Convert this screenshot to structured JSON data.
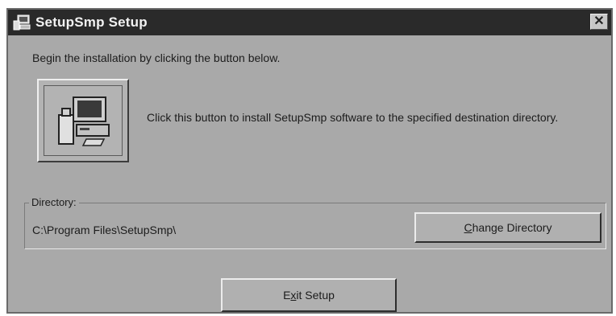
{
  "window": {
    "title": "SetupSmp Setup",
    "close_glyph": "✕"
  },
  "intro_text": "Begin the installation by clicking the button below.",
  "install": {
    "icon": "computer-install-icon",
    "description": "Click this button to install SetupSmp software to the specified destination directory."
  },
  "directory": {
    "legend": "Directory:",
    "path": "C:\\Program Files\\SetupSmp\\"
  },
  "buttons": {
    "change_directory": {
      "mnemonic": "C",
      "rest": "hange Directory"
    },
    "exit_setup": {
      "before": "E",
      "mnemonic": "x",
      "rest": "it Setup"
    }
  },
  "colors": {
    "dialog_bg": "#a9a9a9",
    "titlebar_bg": "#2a2a2a",
    "title_text": "#f2f2f2"
  }
}
